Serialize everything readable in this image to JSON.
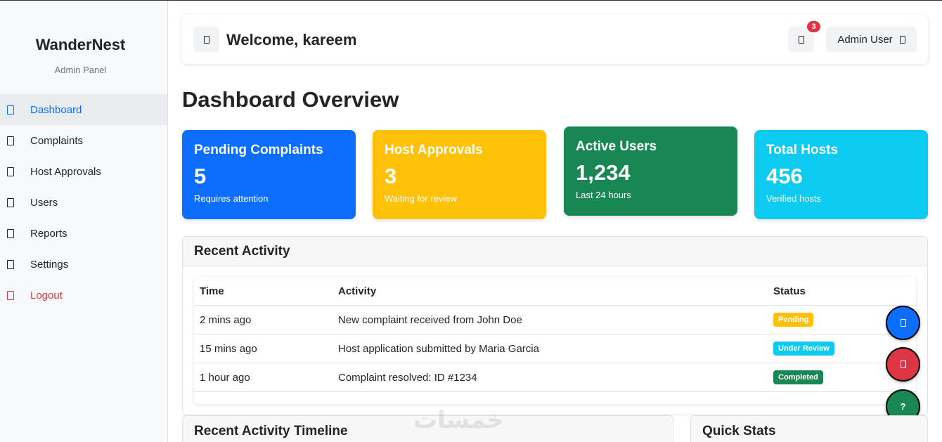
{
  "sidebar": {
    "brand": "WanderNest",
    "subtitle": "Admin Panel",
    "items": [
      {
        "label": "Dashboard",
        "icon": "dashboard-icon",
        "active": true
      },
      {
        "label": "Complaints",
        "icon": "complaints-icon"
      },
      {
        "label": "Host Approvals",
        "icon": "host-approvals-icon"
      },
      {
        "label": "Users",
        "icon": "users-icon"
      },
      {
        "label": "Reports",
        "icon": "reports-icon"
      },
      {
        "label": "Settings",
        "icon": "settings-icon"
      },
      {
        "label": "Logout",
        "icon": "logout-icon",
        "color": "#dc3545"
      }
    ]
  },
  "header": {
    "welcome": "Welcome, kareem",
    "notification_count": "3",
    "user_label": "Admin User"
  },
  "page": {
    "title": "Dashboard Overview"
  },
  "stats": [
    {
      "title": "Pending Complaints",
      "value": "5",
      "subtitle": "Requires attention",
      "color": "#0d6efd"
    },
    {
      "title": "Host Approvals",
      "value": "3",
      "subtitle": "Waiting for review",
      "color": "#ffc107"
    },
    {
      "title": "Active Users",
      "value": "1,234",
      "subtitle": "Last 24 hours",
      "color": "#198754"
    },
    {
      "title": "Total Hosts",
      "value": "456",
      "subtitle": "Verified hosts",
      "color": "#0dcaf0"
    }
  ],
  "activity": {
    "title": "Recent Activity",
    "columns": [
      "Time",
      "Activity",
      "Status"
    ],
    "rows": [
      {
        "time": "2 mins ago",
        "activity": "New complaint received from John Doe",
        "status": "Pending",
        "status_bg": "#ffc107",
        "status_fg": "#ffffff"
      },
      {
        "time": "15 mins ago",
        "activity": "Host application submitted by Maria Garcia",
        "status": "Under Review",
        "status_bg": "#0dcaf0",
        "status_fg": "#ffffff"
      },
      {
        "time": "1 hour ago",
        "activity": "Complaint resolved: ID #1234",
        "status": "Completed",
        "status_bg": "#198754",
        "status_fg": "#ffffff"
      }
    ]
  },
  "fabs": [
    {
      "icon": "chat-icon",
      "color": "#0d6efd"
    },
    {
      "icon": "alert-icon",
      "color": "#dc3545"
    },
    {
      "label": "?",
      "icon": "help-icon",
      "color": "#198754"
    }
  ],
  "panels": {
    "timeline_title": "Recent Activity Timeline",
    "quick_stats_title": "Quick Stats"
  },
  "watermark": "خمسات"
}
